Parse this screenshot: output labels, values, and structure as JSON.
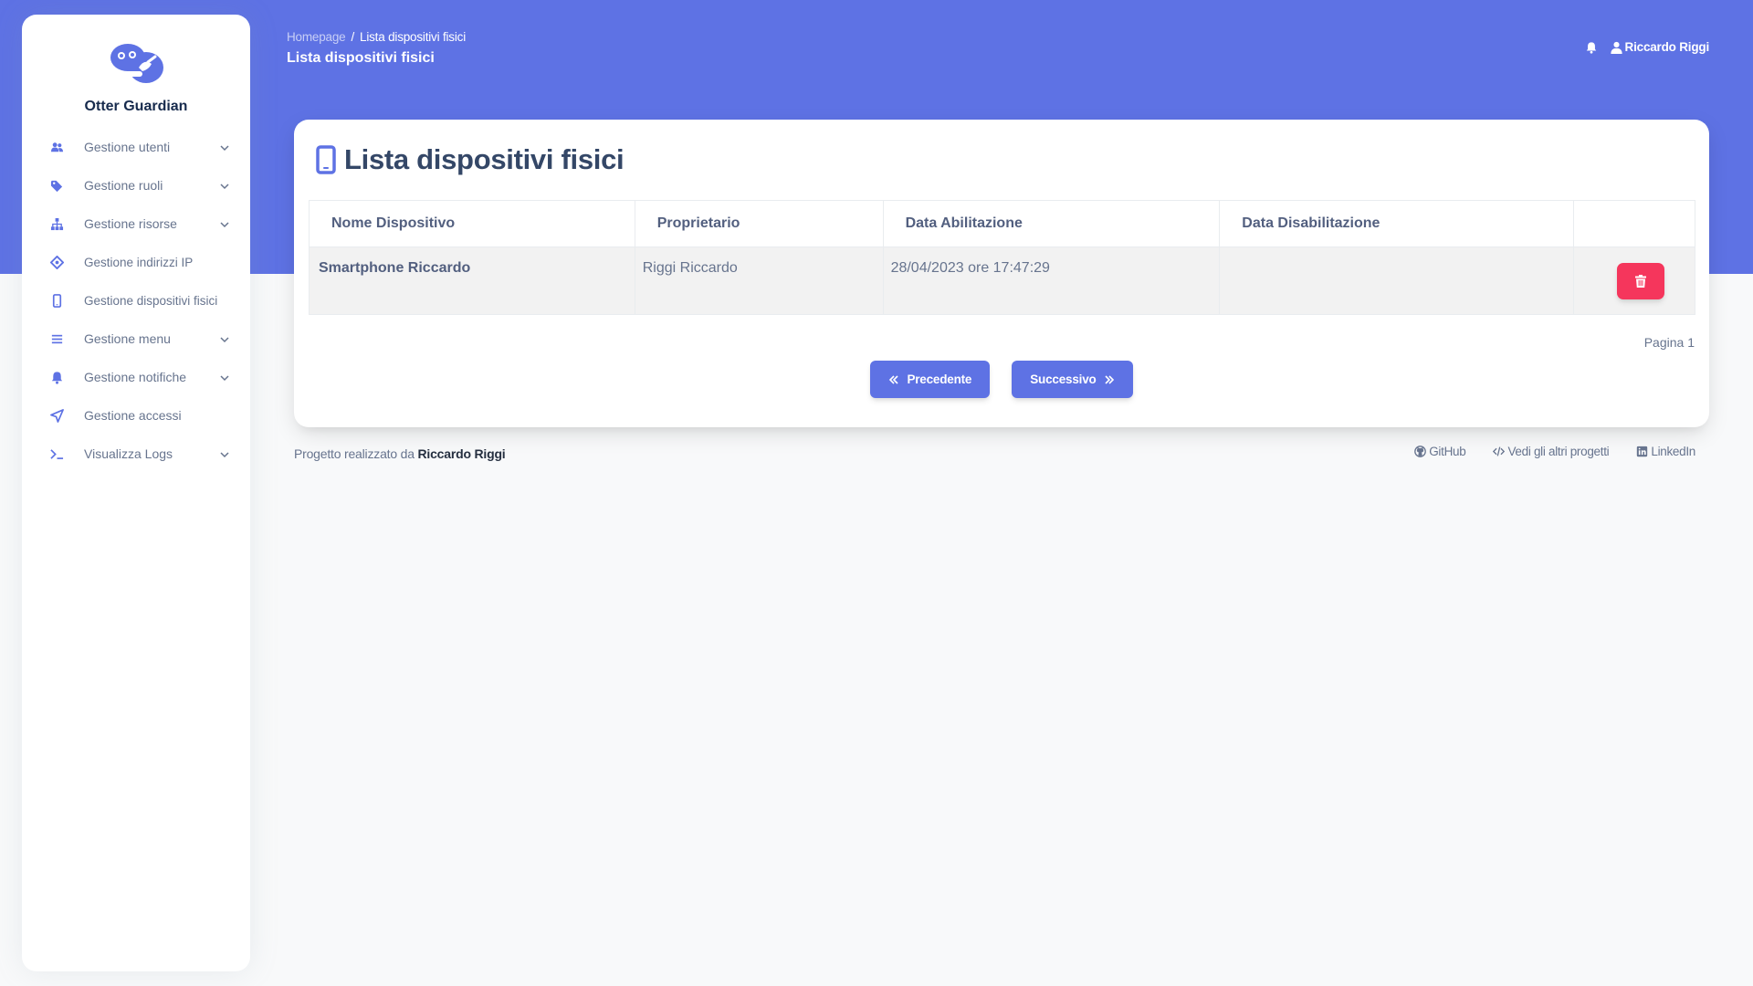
{
  "app": {
    "name": "Otter Guardian"
  },
  "sidebar": {
    "items": [
      {
        "label": "Gestione utenti",
        "icon": "users-icon",
        "expandable": true
      },
      {
        "label": "Gestione ruoli",
        "icon": "tags-icon",
        "expandable": true
      },
      {
        "label": "Gestione risorse",
        "icon": "sitemap-icon",
        "expandable": true
      },
      {
        "label": "Gestione indirizzi IP",
        "icon": "network-icon",
        "expandable": false
      },
      {
        "label": "Gestione dispositivi fisici",
        "icon": "mobile-icon",
        "expandable": false
      },
      {
        "label": "Gestione menu",
        "icon": "menu-icon",
        "expandable": true
      },
      {
        "label": "Gestione notifiche",
        "icon": "bell-icon",
        "expandable": true
      },
      {
        "label": "Gestione accessi",
        "icon": "send-icon",
        "expandable": false
      },
      {
        "label": "Visualizza Logs",
        "icon": "terminal-icon",
        "expandable": true
      }
    ]
  },
  "header": {
    "breadcrumb_home": "Homepage",
    "breadcrumb_separator": "/",
    "breadcrumb_current": "Lista dispositivi fisici",
    "page_title": "Lista dispositivi fisici",
    "user_name": "Riccardo Riggi"
  },
  "card": {
    "title": "Lista dispositivi fisici",
    "columns": [
      "Nome Dispositivo",
      "Proprietario",
      "Data Abilitazione",
      "Data Disabilitazione",
      ""
    ],
    "rows": [
      {
        "nome": "Smartphone Riccardo",
        "proprietario": "Riggi Riccardo",
        "abilitazione": "28/04/2023 ore 17:47:29",
        "disabilitazione": ""
      }
    ],
    "page_label": "Pagina 1",
    "prev_label": "Precedente",
    "next_label": "Successivo"
  },
  "footer": {
    "credit_prefix": "Progetto realizzato da",
    "credit_name": "Riccardo Riggi",
    "links": [
      "GitHub",
      "Vedi gli altri progetti",
      "LinkedIn"
    ]
  },
  "colors": {
    "primary": "#5e72e4",
    "danger": "#f5365c",
    "text": "#344767",
    "muted": "#67748e"
  }
}
